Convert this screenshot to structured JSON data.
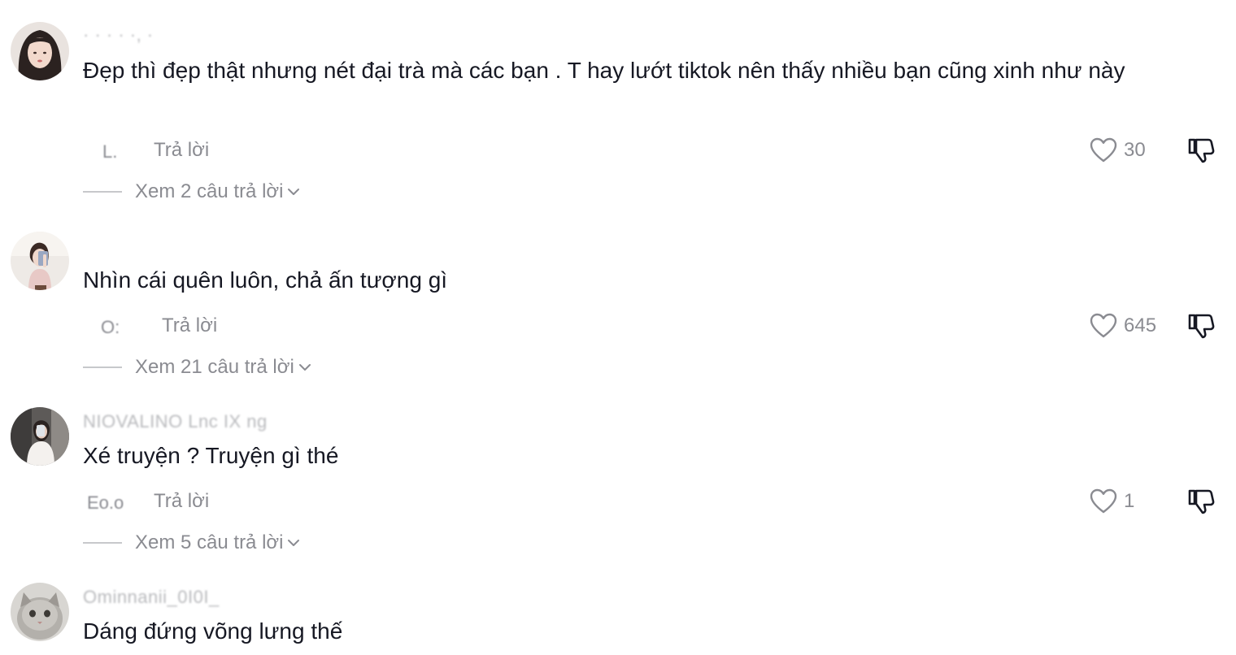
{
  "comments": [
    {
      "username": "· ·  ·   · ·, ·",
      "text": "Đẹp thì đẹp thật nhưng nét đại trà mà các bạn . T hay lướt tiktok nên thấy nhiều bạn cũng xinh như này",
      "date": "L.",
      "reply_label": "Trả lời",
      "likes": "30",
      "view_replies_label": "Xem 2 câu trả lời",
      "avatar_icon": "user-avatar-woman"
    },
    {
      "username": "",
      "text": "Nhìn cái quên luôn, chả ấn tượng gì",
      "date": "O:",
      "reply_label": "Trả lời",
      "likes": "645",
      "view_replies_label": "Xem 21 câu trả lời",
      "avatar_icon": "user-avatar-selfie"
    },
    {
      "username": "NIOVALINO Lnc IX ng",
      "text": "Xé truyện ? Truyện gì thé",
      "date": "Eo.o",
      "reply_label": "Trả lời",
      "likes": "1",
      "view_replies_label": "Xem 5 câu trả lời",
      "avatar_icon": "user-avatar-mirror"
    },
    {
      "username": "Ominnanii_0I0I_",
      "text": "Dáng đứng võng lưng thế",
      "avatar_icon": "user-avatar-cat"
    }
  ],
  "icons": {
    "like": "heart-outline-icon",
    "dislike": "thumbs-down-icon",
    "expand": "chevron-down-icon"
  },
  "colors": {
    "text": "#161823",
    "secondary": "#8a8b91",
    "divider": "#c7c8cb"
  }
}
